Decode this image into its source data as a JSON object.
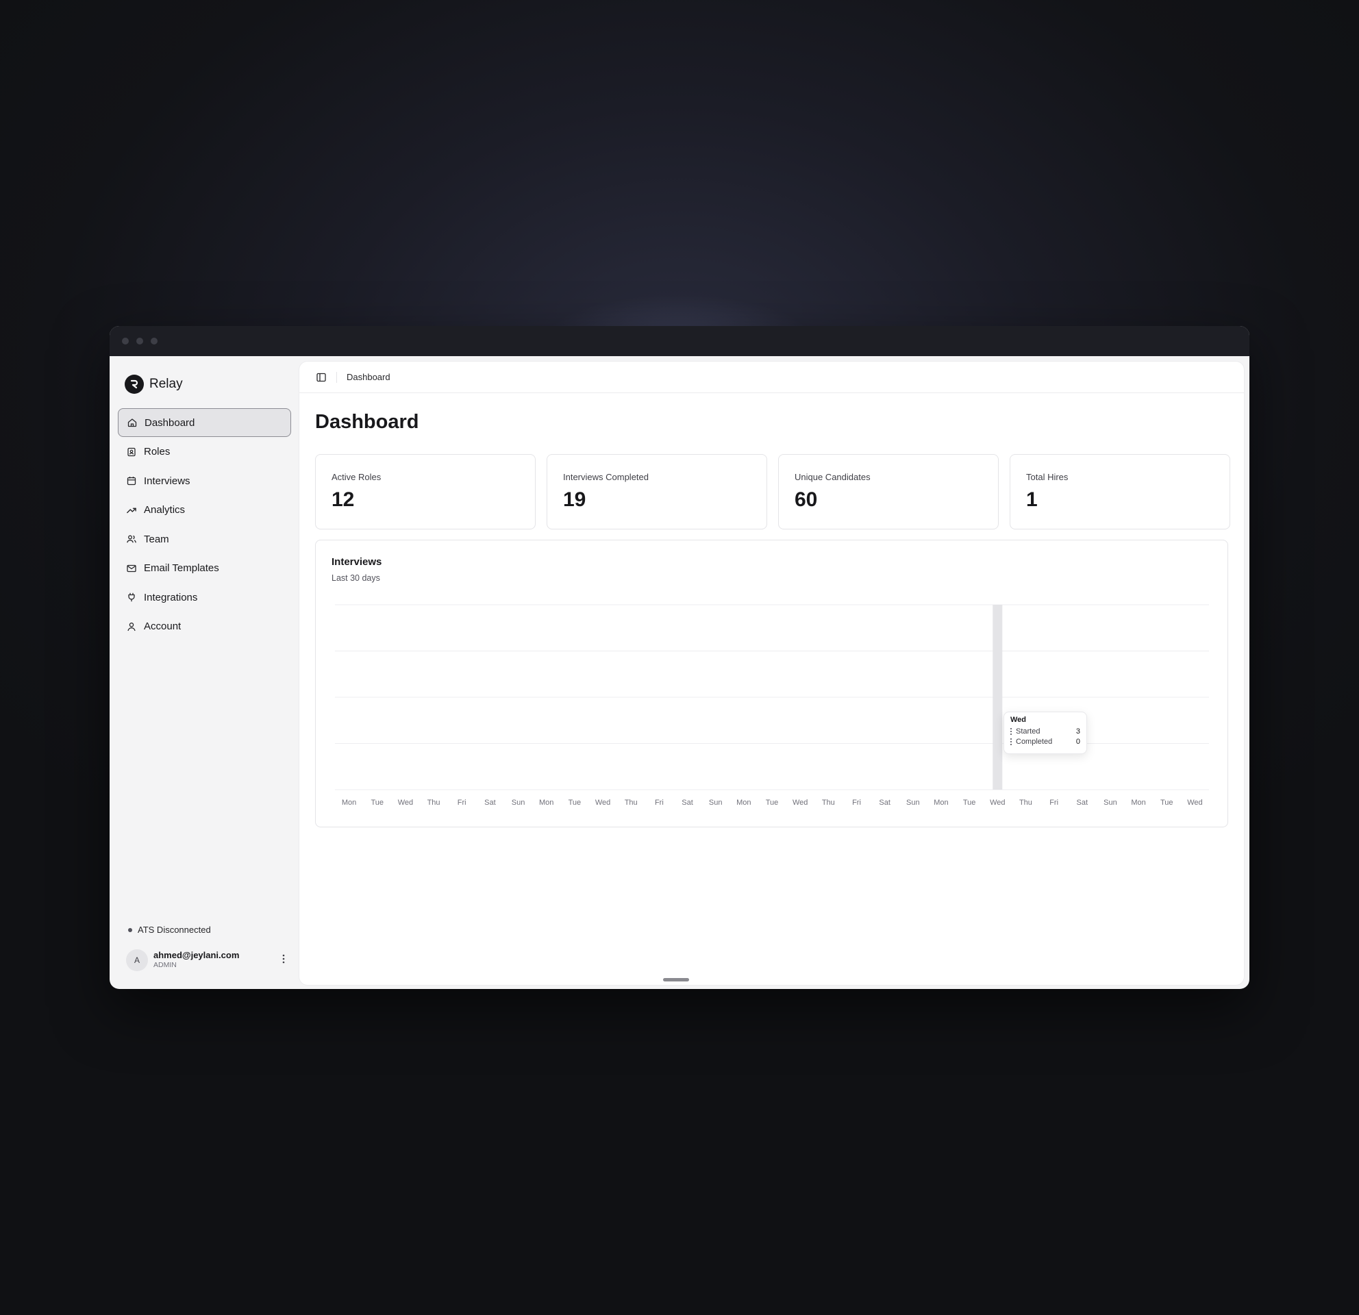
{
  "app": {
    "name": "Relay"
  },
  "sidebar": {
    "items": [
      {
        "label": "Dashboard",
        "icon": "home-icon",
        "active": true
      },
      {
        "label": "Roles",
        "icon": "badge-icon"
      },
      {
        "label": "Interviews",
        "icon": "calendar-icon"
      },
      {
        "label": "Analytics",
        "icon": "trending-up-icon"
      },
      {
        "label": "Team",
        "icon": "users-icon"
      },
      {
        "label": "Email Templates",
        "icon": "mail-icon"
      },
      {
        "label": "Integrations",
        "icon": "plug-icon"
      },
      {
        "label": "Account",
        "icon": "user-icon"
      }
    ],
    "ats_status": "ATS Disconnected",
    "user": {
      "avatar": "A",
      "email": "ahmed@jeylani.com",
      "role": "ADMIN"
    }
  },
  "header": {
    "breadcrumb": "Dashboard"
  },
  "main": {
    "title": "Dashboard",
    "stats": [
      {
        "label": "Active Roles",
        "value": "12"
      },
      {
        "label": "Interviews Completed",
        "value": "19"
      },
      {
        "label": "Unique Candidates",
        "value": "60"
      },
      {
        "label": "Total Hires",
        "value": "1"
      }
    ]
  },
  "chart": {
    "title": "Interviews",
    "subtitle": "Last 30 days",
    "tooltip": {
      "title": "Wed",
      "rows": [
        {
          "label": "Started",
          "value": "3"
        },
        {
          "label": "Completed",
          "value": "0"
        }
      ]
    }
  },
  "chart_data": {
    "type": "bar",
    "title": "Interviews",
    "subtitle": "Last 30 days",
    "categories": [
      "Mon",
      "Tue",
      "Wed",
      "Thu",
      "Fri",
      "Sat",
      "Sun",
      "Mon",
      "Tue",
      "Wed",
      "Thu",
      "Fri",
      "Sat",
      "Sun",
      "Mon",
      "Tue",
      "Wed",
      "Thu",
      "Fri",
      "Sat",
      "Sun",
      "Mon",
      "Tue",
      "Wed",
      "Thu",
      "Fri",
      "Sat",
      "Sun",
      "Mon",
      "Tue",
      "Wed"
    ],
    "series": [
      {
        "name": "Started",
        "values": [
          0,
          0,
          0,
          0,
          0,
          0,
          0,
          0,
          0,
          0,
          0,
          0,
          0,
          0,
          0,
          0,
          0,
          0,
          0,
          0,
          0,
          0,
          0,
          3,
          0,
          0,
          0,
          0,
          0,
          0,
          0
        ]
      },
      {
        "name": "Completed",
        "values": [
          0,
          0,
          0,
          0,
          0,
          0,
          0,
          0,
          0,
          0,
          0,
          0,
          0,
          0,
          0,
          0,
          0,
          0,
          0,
          0,
          0,
          0,
          0,
          0,
          0,
          0,
          0,
          0,
          0,
          0,
          0
        ]
      }
    ],
    "highlighted_index": 23,
    "grid": true,
    "gridlines": 5
  },
  "colors": {
    "accent": "#18181b",
    "highlight": "#e4e4e7",
    "background_dark": "#121317"
  }
}
